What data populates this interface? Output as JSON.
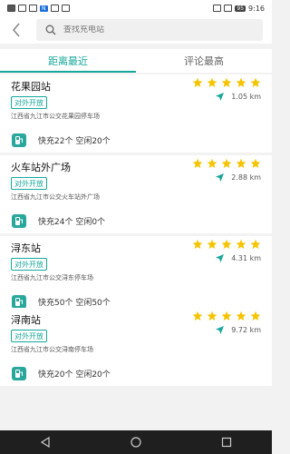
{
  "status_bar": {
    "time": "9:16",
    "battery": "95"
  },
  "search": {
    "placeholder": "查找充电站"
  },
  "tabs": [
    {
      "label": "距离最近",
      "active": true
    },
    {
      "label": "评论最高",
      "active": false
    }
  ],
  "stations": [
    {
      "name": "花果园站",
      "tag": "对外开放",
      "address": "江西省九江市公交花果园停车场",
      "rating": 5,
      "distance": "1.05 km",
      "charge_info": "快充22个 空闲20个"
    },
    {
      "name": "火车站外广场",
      "tag": "对外开放",
      "address": "江西省九江市公交火车站外广场",
      "rating": 5,
      "distance": "2.88 km",
      "charge_info": "快充24个 空闲0个"
    },
    {
      "name": "浔东站",
      "tag": "对外开放",
      "address": "江西省九江市公交浔东停车场",
      "rating": 5,
      "distance": "4.31 km",
      "charge_info": "快充50个 空闲50个"
    },
    {
      "name": "浔南站",
      "tag": "对外开放",
      "address": "江西省九江市公交浔南停车场",
      "rating": 5,
      "distance": "9.72 km",
      "charge_info": "快充20个 空闲20个"
    }
  ],
  "colors": {
    "accent": "#15a89b",
    "star": "#f4c400"
  }
}
